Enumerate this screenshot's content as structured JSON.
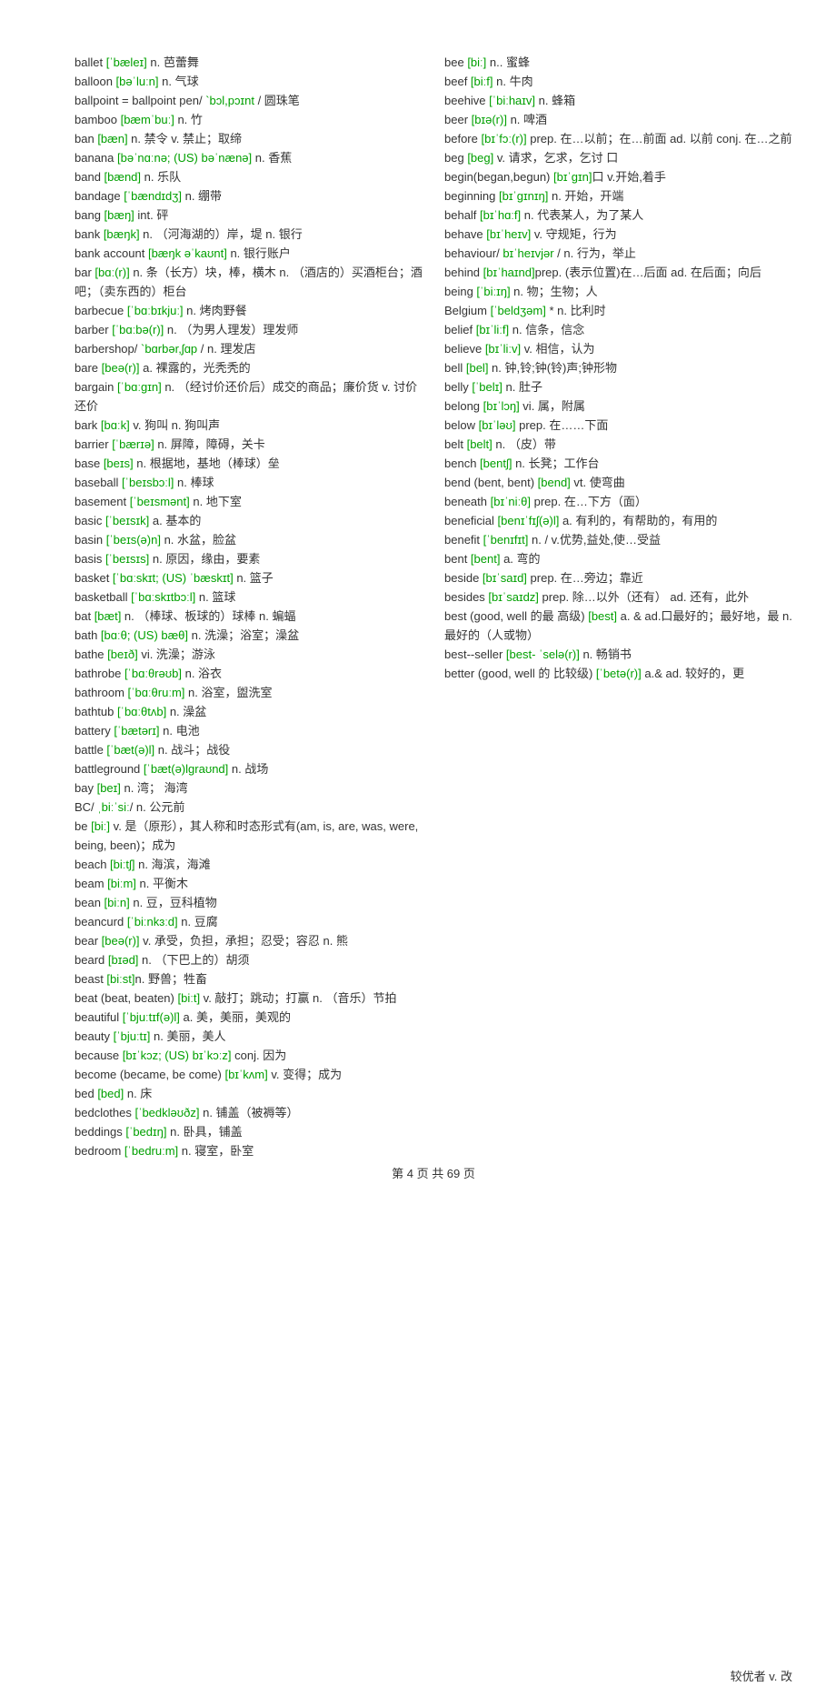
{
  "footer": "第 4 页 共 69 页",
  "tail": "较优者 v. 改",
  "left": [
    {
      "w": "ballet",
      "p": "[ˈbæleɪ]",
      "d": " n. 芭蕾舞"
    },
    {
      "w": "balloon",
      "p": "[bəˈluːn]",
      "d": " n. 气球"
    },
    {
      "w": "ballpoint = ballpoint pen/",
      "p": " `bɔl,pɔɪnt ",
      "d": "/ 圆珠笔"
    },
    {
      "w": "bamboo",
      "p": "[bæmˈbuː]",
      "d": " n. 竹"
    },
    {
      "w": "ban",
      "p": "[bæn]",
      "d": " n. 禁令 v. 禁止；取缔"
    },
    {
      "w": "banana",
      "p": "[bəˈnɑːnə; (US) bəˈnænə]",
      "d": " n. 香蕉"
    },
    {
      "w": "band",
      "p": "[bænd]",
      "d": " n. 乐队"
    },
    {
      "w": "bandage",
      "p": "[ˈbændɪdʒ]",
      "d": " n. 绷带"
    },
    {
      "w": "bang",
      "p": "[bæŋ]",
      "d": " int. 砰"
    },
    {
      "w": "bank",
      "p": "[bæŋk]",
      "d": " n. （河海湖的）岸，堤 n. 银行"
    },
    {
      "w": "bank account",
      "p": "[bæŋk əˈkaʊnt]",
      "d": " n. 银行账户"
    },
    {
      "w": "bar",
      "p": "[bɑː(r)]",
      "d": " n. 条（长方）块，棒，横木 n. （酒店的）买酒柜台；酒吧；（卖东西的）柜台"
    },
    {
      "w": "barbecue",
      "p": "[ˈbɑːbɪkjuː]",
      "d": " n. 烤肉野餐"
    },
    {
      "w": "barber",
      "p": "[ˈbɑːbə(r)]",
      "d": " n. （为男人理发）理发师"
    },
    {
      "w": "barbershop/",
      "p": " `bɑrbər,ʃɑp ",
      "d": "/ n. 理发店"
    },
    {
      "w": "bare",
      "p": "[beə(r)]",
      "d": " a. 裸露的，光秃秃的"
    },
    {
      "w": "bargain",
      "p": "[ˈbɑːɡɪn]",
      "d": " n. （经讨价还价后）成交的商品；廉价货 v. 讨价还价"
    },
    {
      "w": "bark",
      "p": "[bɑːk]",
      "d": " v. 狗叫 n. 狗叫声"
    },
    {
      "w": "barrier",
      "p": "[ˈbærɪə]",
      "d": " n. 屏障，障碍，关卡"
    },
    {
      "w": "base",
      "p": "[beɪs]",
      "d": " n. 根据地，基地（棒球）垒"
    },
    {
      "w": "baseball",
      "p": "[ˈbeɪsbɔːl]",
      "d": " n. 棒球"
    },
    {
      "w": "basement",
      "p": "[ˈbeɪsmənt]",
      "d": " n. 地下室"
    },
    {
      "w": "basic",
      "p": "[ˈbeɪsɪk]",
      "d": " a. 基本的"
    },
    {
      "w": "basin",
      "p": "[ˈbeɪs(ə)n]",
      "d": " n. 水盆，脸盆"
    },
    {
      "w": "basis",
      "p": "[ˈbeɪsɪs]",
      "d": " n. 原因，缘由，要素"
    },
    {
      "w": "basket",
      "p": "[ˈbɑːskɪt; (US) ˈbæskɪt]",
      "d": " n. 篮子"
    },
    {
      "w": "basketball",
      "p": "[ˈbɑːskɪtbɔːl]",
      "d": " n. 篮球"
    },
    {
      "w": "bat",
      "p": "[bæt]",
      "d": " n. （棒球、板球的）球棒 n. 蝙蝠"
    },
    {
      "w": "bath",
      "p": "[bɑːθ; (US) bæθ]",
      "d": " n. 洗澡；浴室；澡盆"
    },
    {
      "w": "bathe",
      "p": "[beɪð]",
      "d": " vi. 洗澡；游泳"
    },
    {
      "w": "bathrobe",
      "p": "[ˈbɑːθrəʊb]",
      "d": " n. 浴衣"
    },
    {
      "w": "bathroom",
      "p": "[ˈbɑːθruːm]",
      "d": " n. 浴室，盥洗室"
    },
    {
      "w": "bathtub",
      "p": "[ˈbɑːθtʌb]",
      "d": "  n. 澡盆"
    },
    {
      "w": "battery",
      "p": "[ˈbætərɪ]",
      "d": " n. 电池"
    },
    {
      "w": "battle",
      "p": "[ˈbæt(ə)l]",
      "d": " n. 战斗；战役"
    },
    {
      "w": "battleground",
      "p": "[ˈbæt(ə)lɡraʊnd]",
      "d": " n. 战场"
    },
    {
      "w": "bay",
      "p": "[beɪ]",
      "d": " n. 湾； 海湾"
    },
    {
      "w": "BC/",
      "p": "ˌbiːˈsiː",
      "d": "/ n. 公元前"
    },
    {
      "w": "be",
      "p": "[biː]",
      "d": " v. 是（原形），其人称和时态形式有(am, is, are, was, were, being, been)；成为"
    },
    {
      "w": "beach",
      "p": "[biːtʃ]",
      "d": " n. 海滨，海滩"
    },
    {
      "w": "beam",
      "p": "[biːm]",
      "d": " n. 平衡木"
    },
    {
      "w": "bean",
      "p": "[biːn]",
      "d": " n. 豆，豆科植物"
    },
    {
      "w": "beancurd",
      "p": "[ˈbiːnkɜːd]",
      "d": " n. 豆腐"
    },
    {
      "w": "bear",
      "p": "[beə(r)]",
      "d": " v. 承受，负担，承担；忍受；容忍 n. 熊"
    },
    {
      "w": "beard",
      "p": "[bɪəd]",
      "d": " n. （下巴上的）胡须"
    },
    {
      "w": "beast",
      "p": "[biːst]",
      "d": "n. 野兽；牲畜"
    },
    {
      "w": "beat (beat, beaten)",
      "p": "[biːt]",
      "d": " v. 敲打；跳动；打赢 n. （音乐）节拍"
    },
    {
      "w": "beautiful",
      "p": "[ˈbjuːtɪf(ə)l]",
      "d": " a. 美，美丽，美观的"
    },
    {
      "w": "beauty",
      "p": "[ˈbjuːtɪ]",
      "d": " n. 美丽，美人"
    },
    {
      "w": "because",
      "p": "[bɪˈkɔz; (US) bɪˈkɔːz]",
      "d": " conj. 因为"
    },
    {
      "w": "become (became, be come)",
      "p": "[bɪˈkʌm]",
      "d": " v. 变得；成为"
    },
    {
      "w": "bed",
      "p": "[bed]",
      "d": " n. 床"
    },
    {
      "w": "bedclothes",
      "p": "[ˈbedkləʊðz]",
      "d": " n. 铺盖（被褥等）"
    },
    {
      "w": "beddings",
      "p": "[ˈbedɪŋ]",
      "d": " n. 卧具，铺盖"
    },
    {
      "w": "bedroom",
      "p": "[ˈbedruːm]",
      "d": " n. 寝室，卧室"
    }
  ],
  "right": [
    {
      "w": "bee",
      "p": "[biː]",
      "d": " n.. 蜜蜂"
    },
    {
      "w": "beef",
      "p": "[biːf]",
      "d": " n. 牛肉"
    },
    {
      "w": "beehive",
      "p": "[ˈbiːhaɪv]",
      "d": " n. 蜂箱"
    },
    {
      "w": "beer",
      "p": "[bɪə(r)]",
      "d": " n. 啤酒"
    },
    {
      "w": "before",
      "p": "[bɪˈfɔː(r)]",
      "d": " prep. 在…以前；在…前面 ad. 以前 conj. 在…之前"
    },
    {
      "w": "beg",
      "p": "[beɡ]",
      "d": " v. 请求，乞求，乞讨 口"
    },
    {
      "w": "begin(began,begun)",
      "p": "[bɪˈɡɪn]",
      "d": "口 v.开始,着手"
    },
    {
      "w": "beginning",
      "p": "[bɪˈɡɪnɪŋ]",
      "d": " n. 开始，开端"
    },
    {
      "w": "behalf",
      "p": "[bɪˈhɑːf]",
      "d": " n. 代表某人，为了某人"
    },
    {
      "w": "behave",
      "p": "[bɪˈheɪv]",
      "d": " v. 守规矩，行为"
    },
    {
      "w": "behaviour/",
      "p": " bɪˈheɪvjər ",
      "d": "/  n. 行为，举止"
    },
    {
      "w": "behind",
      "p": "[bɪˈhaɪnd]",
      "d": "prep. (表示位置)在…后面 ad. 在后面；向后"
    },
    {
      "w": "being",
      "p": "[ˈbiːɪŋ]",
      "d": " n. 物；生物；人"
    },
    {
      "w": "Belgium",
      "p": "[ˈbeldʒəm]",
      "d": " * n. 比利时"
    },
    {
      "w": "belief",
      "p": "[bɪˈliːf]",
      "d": " n. 信条，信念"
    },
    {
      "w": "believe",
      "p": "[bɪˈliːv]",
      "d": " v. 相信，认为"
    },
    {
      "w": "bell",
      "p": "[bel]",
      "d": " n. 钟,铃;钟(铃)声;钟形物"
    },
    {
      "w": "belly",
      "p": "[ˈbelɪ]",
      "d": " n. 肚子"
    },
    {
      "w": "belong",
      "p": "[bɪˈlɔŋ]",
      "d": " vi. 属，附属"
    },
    {
      "w": "below",
      "p": "[bɪˈləʊ]",
      "d": " prep. 在……下面"
    },
    {
      "w": "belt",
      "p": "[belt]",
      "d": " n. （皮）带"
    },
    {
      "w": "bench",
      "p": "[bentʃ]",
      "d": " n. 长凳；工作台"
    },
    {
      "w": "bend (bent, bent)",
      "p": "[bend]",
      "d": " vt. 使弯曲"
    },
    {
      "w": "beneath",
      "p": "[bɪˈniːθ]",
      "d": " prep. 在…下方（面）"
    },
    {
      "w": "beneficial",
      "p": "[benɪˈfɪʃ(ə)l]",
      "d": " a. 有利的，有帮助的，有用的"
    },
    {
      "w": "benefit",
      "p": "[ˈbenɪfɪt]",
      "d": " n. / v.优势,益处,使…受益"
    },
    {
      "w": "bent",
      "p": "[bent]",
      "d": " a. 弯的"
    },
    {
      "w": "beside",
      "p": "[bɪˈsaɪd]",
      "d": " prep. 在…旁边；靠近"
    },
    {
      "w": "besides",
      "p": "[bɪˈsaɪdz]",
      "d": " prep. 除…以外（还有） ad. 还有，此外"
    },
    {
      "w": "best (good, well 的最 高级) ",
      "p": "[best]",
      "d": " a. & ad.口最好的；最好地，最 n. 最好的（人或物）"
    },
    {
      "w": "best--seller",
      "p": "[best- ˈselə(r)]",
      "d": " n. 畅销书"
    },
    {
      "w": "better (good, well 的 比较级)",
      "p": "[ˈbetə(r)]",
      "d": " a.& ad. 较好的，更"
    }
  ]
}
